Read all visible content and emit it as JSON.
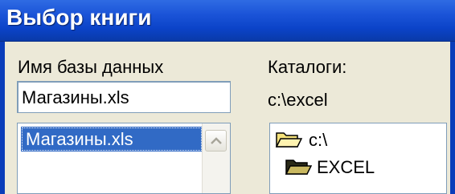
{
  "window": {
    "title": "Выбор книги"
  },
  "database": {
    "label": "Имя базы данных",
    "value": "Магазины.xls",
    "list": [
      {
        "name": "Магазины.xls",
        "selected": true
      }
    ]
  },
  "directories": {
    "label": "Каталоги:",
    "current_path": "c:\\excel",
    "tree": [
      {
        "name": "c:\\",
        "icon": "folder-open-icon"
      },
      {
        "name": "EXCEL",
        "icon": "folder-open-icon"
      }
    ]
  },
  "colors": {
    "titlebar": "#0b43c8",
    "selection": "#316ac5",
    "dialog_bg": "#ece9d8"
  }
}
